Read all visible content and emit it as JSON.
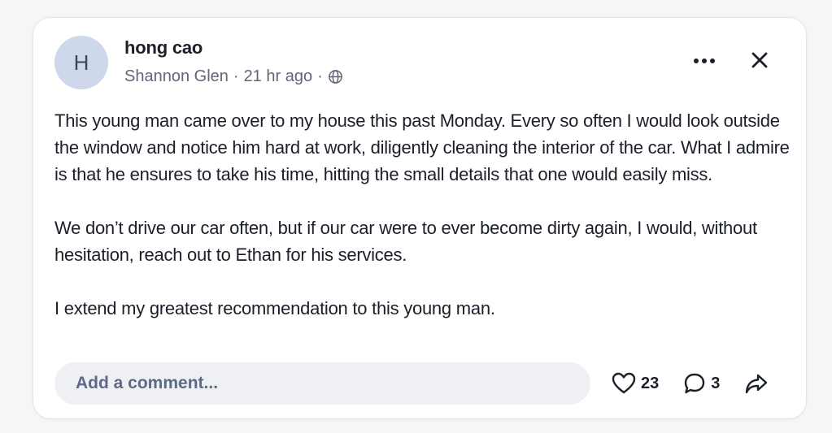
{
  "post": {
    "avatar_initial": "H",
    "author": "hong cao",
    "location": "Shannon Glen",
    "separator": "·",
    "time_ago": "21 hr ago",
    "visibility_icon": "globe-icon",
    "paragraphs": [
      "This young man came over to my house this past Monday. Every so often I would look outside the window and notice him hard at work, diligently cleaning the interior of the car. What I admire is that he ensures to take his time, hitting the small details that one would easily miss.",
      "We don’t drive our car often, but if our car were to ever become dirty again, I would, without hesitation, reach out to Ethan for his services.",
      "I extend my greatest recommendation to this young man."
    ]
  },
  "header_actions": {
    "more_icon": "more-horizontal-icon",
    "close_icon": "close-icon"
  },
  "footer": {
    "comment_placeholder": "Add a comment...",
    "like_count": "23",
    "comment_count": "3",
    "like_icon": "heart-icon",
    "comment_icon": "comment-bubble-icon",
    "share_icon": "share-arrow-icon"
  },
  "colors": {
    "avatar_bg": "#cfd8ea",
    "text": "#1b1f29",
    "muted": "#5f6678",
    "input_bg": "#eef0f4"
  }
}
